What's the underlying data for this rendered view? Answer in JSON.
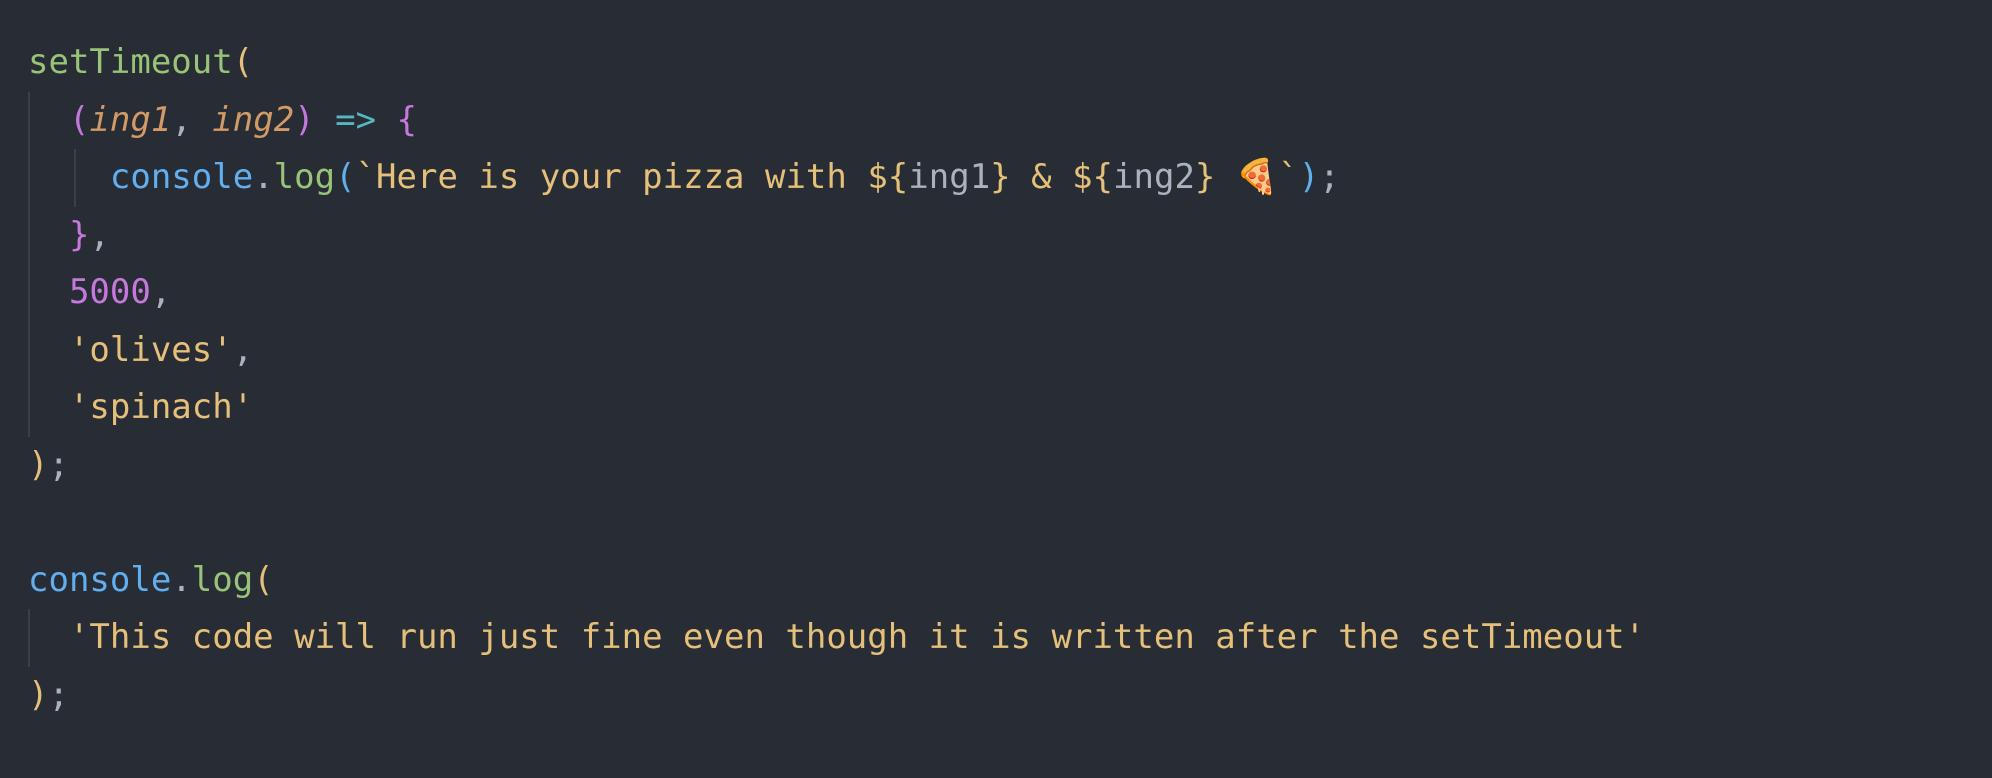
{
  "code": {
    "line1": {
      "fn": "setTimeout",
      "open": "("
    },
    "line2": {
      "open": "(",
      "p1": "ing1",
      "comma": ", ",
      "p2": "ing2",
      "close": ")",
      "arrow": " => ",
      "brace": "{"
    },
    "line3": {
      "obj": "console",
      "dot": ".",
      "method": "log",
      "open": "(",
      "tmpl_start": "`Here is your pizza with ",
      "interp1_open": "${",
      "var1": "ing1",
      "interp1_close": "}",
      "amp": " & ",
      "interp2_open": "${",
      "var2": "ing2",
      "interp2_close": "}",
      "space": " ",
      "emoji": "🍕",
      "tmpl_end": "`",
      "close": ")",
      "semi": ";"
    },
    "line4": {
      "brace": "}",
      "comma": ","
    },
    "line5": {
      "num": "5000",
      "comma": ","
    },
    "line6": {
      "str": "'olives'",
      "comma": ","
    },
    "line7": {
      "str": "'spinach'"
    },
    "line8": {
      "close": ")",
      "semi": ";"
    },
    "line10": {
      "obj": "console",
      "dot": ".",
      "method": "log",
      "open": "("
    },
    "line11": {
      "str": "'This code will run just fine even though it is written after the setTimeout'"
    },
    "line12": {
      "close": ")",
      "semi": ";"
    }
  },
  "colors": {
    "background": "#282c34",
    "function_green": "#98c379",
    "object_blue": "#61afef",
    "string_yellow": "#e5c07b",
    "keyword_purple": "#c678dd",
    "param_orange": "#d19a66",
    "operator_cyan": "#56b6c2",
    "text_gray": "#abb2bf"
  }
}
